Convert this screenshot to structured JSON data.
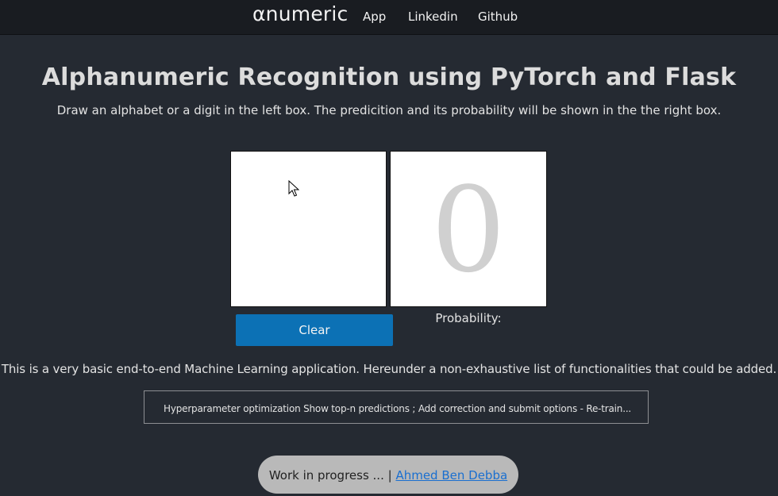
{
  "navbar": {
    "brand": "αnumeric",
    "links": [
      "App",
      "Linkedin",
      "Github"
    ]
  },
  "main": {
    "title": "Alphanumeric Recognition using PyTorch and Flask",
    "subtitle": "Draw an alphabet or a digit in the left box. The predicition and its probability will be shown in the the right box.",
    "prediction": "0",
    "clear_label": "Clear",
    "probability_label": "Probability:",
    "description": "This is a very basic end-to-end Machine Learning application. Hereunder a non-exhaustive list of functionalities that could be added.",
    "features_text": "Hyperparameter optimization Show top-n predictions ; Add correction and submit options - Re-train..."
  },
  "footer": {
    "text": "Work in progress ... |",
    "author": "Ahmed Ben Debba"
  },
  "colors": {
    "background": "#252a32",
    "navbar": "#191c21",
    "button": "#0c71b5",
    "footer_pill": "#b9b9b9",
    "link": "#1a6fd0"
  },
  "icons": {
    "cursor": "mouse-pointer-icon"
  }
}
